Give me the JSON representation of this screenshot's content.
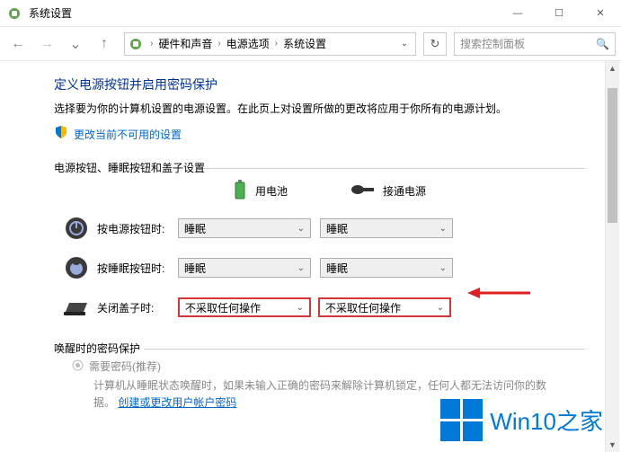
{
  "window": {
    "title": "系统设置",
    "min_glyph": "—",
    "max_glyph": "☐",
    "close_glyph": "✕"
  },
  "nav": {
    "back_glyph": "←",
    "fwd_glyph": "→",
    "up_glyph": "↑",
    "dropdown_glyph": "⌄",
    "refresh_glyph": "↻"
  },
  "breadcrumbs": {
    "sep": "›",
    "items": [
      "硬件和声音",
      "电源选项",
      "系统设置"
    ]
  },
  "search": {
    "placeholder": "搜索控制面板",
    "icon": "🔍"
  },
  "page": {
    "heading": "定义电源按钮并启用密码保护",
    "subtitle": "选择要为你的计算机设置的电源设置。在此页上对设置所做的更改将应用于你所有的电源计划。",
    "change_link": "更改当前不可用的设置"
  },
  "section1": {
    "title": "电源按钮、睡眠按钮和盖子设置",
    "col1": "用电池",
    "col2": "接通电源",
    "rows": [
      {
        "label": "按电源按钮时:",
        "v1": "睡眠",
        "v2": "睡眠"
      },
      {
        "label": "按睡眠按钮时:",
        "v1": "睡眠",
        "v2": "睡眠"
      },
      {
        "label": "关闭盖子时:",
        "v1": "不采取任何操作",
        "v2": "不采取任何操作"
      }
    ]
  },
  "section2": {
    "title": "唤醒时的密码保护",
    "radio1": "需要密码(推荐)",
    "desc": "计算机从睡眠状态唤醒时，如果未输入正确的密码来解除计算机锁定，任何人都无法访问你的数据。",
    "link": "创建或更改用户帐户密码"
  },
  "watermark": "Win10之家"
}
